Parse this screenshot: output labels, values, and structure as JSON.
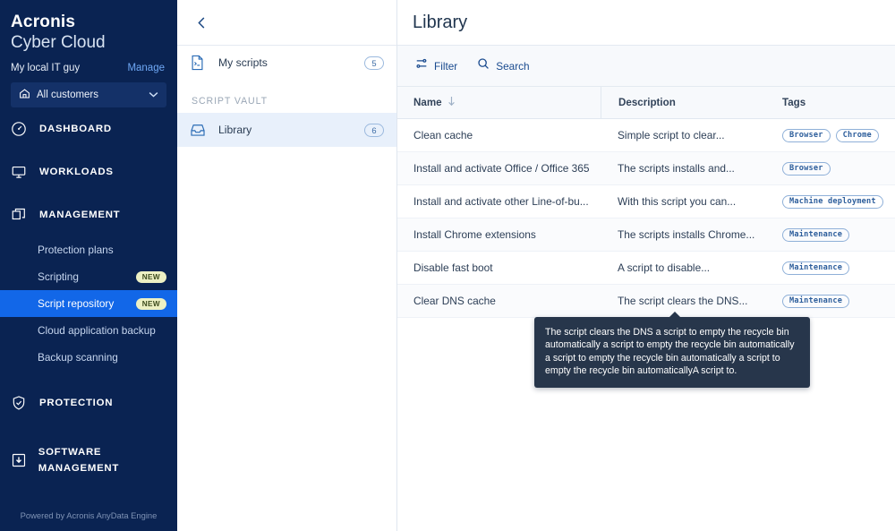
{
  "brand": {
    "line1": "Acronis",
    "line2": "Cyber Cloud"
  },
  "tenant": {
    "name": "My local IT guy",
    "manage_label": "Manage",
    "customers_label": "All customers"
  },
  "sidebar": {
    "items": [
      {
        "label": "DASHBOARD",
        "icon": "gauge-icon"
      },
      {
        "label": "WORKLOADS",
        "icon": "monitor-icon"
      },
      {
        "label": "MANAGEMENT",
        "icon": "layers-icon"
      },
      {
        "label": "PROTECTION",
        "icon": "shield-check-icon"
      },
      {
        "label": "SOFTWARE MANAGEMENT",
        "icon": "download-box-icon"
      }
    ],
    "management_subitems": [
      {
        "label": "Protection plans",
        "badge": "",
        "active": false
      },
      {
        "label": "Scripting",
        "badge": "NEW",
        "active": false
      },
      {
        "label": "Script repository",
        "badge": "NEW",
        "active": true
      },
      {
        "label": "Cloud application backup",
        "badge": "",
        "active": false
      },
      {
        "label": "Backup scanning",
        "badge": "",
        "active": false
      }
    ],
    "footer": "Powered by Acronis AnyData Engine"
  },
  "midpanel": {
    "back_icon": "chevron-left-icon",
    "my_scripts": {
      "label": "My scripts",
      "count": "5",
      "icon": "script-file-icon"
    },
    "section_label": "SCRIPT VAULT",
    "library": {
      "label": "Library",
      "count": "6",
      "icon": "inbox-icon"
    }
  },
  "main": {
    "title": "Library",
    "toolbar": {
      "filter_label": "Filter",
      "search_label": "Search"
    },
    "table": {
      "columns": [
        "Name",
        "Description",
        "Tags"
      ],
      "sort_column": "Name",
      "sort_direction": "down",
      "rows": [
        {
          "name": "Clean cache",
          "description": "Simple script to clear...",
          "tags": [
            "Browser",
            "Chrome"
          ]
        },
        {
          "name": "Install and activate Office / Office 365",
          "description": "The scripts installs and...",
          "tags": [
            "Browser"
          ]
        },
        {
          "name": "Install and activate other Line-of-bu...",
          "description": "With this script you can...",
          "tags": [
            "Machine deployment"
          ]
        },
        {
          "name": "Install Chrome extensions",
          "description": "The scripts installs Chrome...",
          "tags": [
            "Maintenance"
          ]
        },
        {
          "name": "Disable fast boot",
          "description": "A script to disable...",
          "tags": [
            "Maintenance"
          ]
        },
        {
          "name": "Clear DNS cache",
          "description": "The script clears the DNS...",
          "tags": [
            "Maintenance"
          ]
        }
      ]
    }
  },
  "tooltip": {
    "text": "The script clears the DNS a script to empty the recycle bin automatically a script to empty the recycle bin automatically a script to empty the recycle bin automatically a script to empty the recycle bin automaticallyA script to."
  },
  "colors": {
    "sidebar_bg": "#0A2352",
    "active_nav": "#1267E8",
    "accent_link": "#1a4b8f",
    "badge_new_bg": "#EDF0C4",
    "tag_border": "#8fb0d8",
    "tooltip_bg": "#27364B",
    "selected_row": "#E8F0FB"
  }
}
